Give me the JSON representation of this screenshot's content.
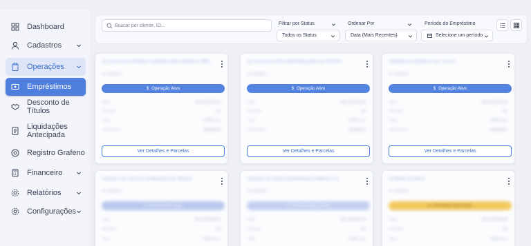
{
  "sidebar": {
    "items": [
      {
        "label": "Dashboard",
        "icon": "dashboard-grid-icon"
      },
      {
        "label": "Cadastros",
        "icon": "user-icon"
      },
      {
        "label": "Operações",
        "icon": "clipboard-icon"
      },
      {
        "label": "Empréstimos",
        "icon": "banknote-icon"
      },
      {
        "label": "Desconto de Títulos",
        "icon": "handshake-icon"
      },
      {
        "label_line1": "Liquidações",
        "label_line2": "Antecipada",
        "icon": "document-list-icon"
      },
      {
        "label": "Registro Grafeno",
        "icon": "target-icon"
      },
      {
        "label": "Financeiro",
        "icon": "calculator-icon"
      },
      {
        "label": "Relatórios",
        "icon": "gear-report-icon"
      },
      {
        "label": "Configurações",
        "icon": "gear-icon"
      }
    ]
  },
  "filters": {
    "search_placeholder": "Buscar por cliente, ID...",
    "status_label": "Filtrar por Status",
    "status_value": "Todos os Status",
    "order_label": "Ordenar Por",
    "order_value": "Data (Mais Recentes)",
    "period_label": "Período do Empréstimo",
    "period_value": "Selecione um período"
  },
  "cards": [
    {
      "title": "EC EXECAO PRIVADA COMUNICADO EMPRESTIMO",
      "sub": "ID: 0000000",
      "status": "Operação Ativo",
      "status_color": "#5584e0",
      "rows": [
        [
          "Valor",
          "R$ 0.000.000,00"
        ],
        [
          "Parcelas",
          "0/0"
        ],
        [
          "Taxa",
          "0,00% a.m."
        ],
        [
          "Vencimento",
          "00/00/0000"
        ]
      ],
      "button": "Ver Detalhes e Parcelas"
    },
    {
      "title": "EC EXECAO DOS PROPRIEDADE DO GRUPO",
      "sub": "ID: 0000000",
      "status": "Operação Ativo",
      "status_color": "#5584e0",
      "rows": [
        [
          "Valor",
          "R$ 0.000.000,00"
        ],
        [
          "Parcelas",
          "0/0"
        ],
        [
          "Taxa",
          "0,00% a.m."
        ],
        [
          "Vencimento",
          "00/00/0000"
        ]
      ],
      "button": "Ver Detalhes e Parcelas"
    },
    {
      "title": "EMPRESA EXEMPLO DE TESTE",
      "sub": "ID: 0000000",
      "status": "Operação Ativo",
      "status_color": "#5584e0",
      "rows": [
        [
          "Valor",
          "R$ 0.000.000,00"
        ],
        [
          "Parcelas",
          "0/0"
        ],
        [
          "Taxa",
          "0,00% a.m."
        ],
        [
          "Vencimento",
          "00/00/0000"
        ]
      ],
      "button": "Ver Detalhes e Parcelas"
    },
    {
      "title": "RALDEZ DE OLIVER COMERCIO DE MEIOS",
      "sub": "ID: 0000000",
      "status": "Processando pago",
      "status_color": "#b9c8ee",
      "rows": [
        [
          "Valor",
          "R$ 0.000.000,00"
        ],
        [
          "Parcelas",
          "0/0"
        ],
        [
          "Taxa",
          "0,00% a.m."
        ]
      ],
      "button": ""
    },
    {
      "title": "RALDEZ DA SILVA GUIMARAES RAMOS LTD",
      "sub": "ID: 0000000",
      "status": "Processando parcial",
      "status_color": "#c4cff0",
      "rows": [
        [
          "Valor",
          "R$ 0.000.000,00"
        ],
        [
          "Parcelas",
          "0/0"
        ],
        [
          "Taxa",
          "0,00% a.m."
        ]
      ],
      "button": ""
    },
    {
      "title": "ICARBETECNICA",
      "sub": "ID: 0000000",
      "status": "Pendente Aprovação",
      "status_color": "#f2c95e",
      "rows": [
        [
          "Valor",
          "R$ 0.000.000,00"
        ],
        [
          "Parcelas",
          "0/0"
        ],
        [
          "Taxa",
          "0,00% a.m."
        ]
      ],
      "button": ""
    }
  ]
}
